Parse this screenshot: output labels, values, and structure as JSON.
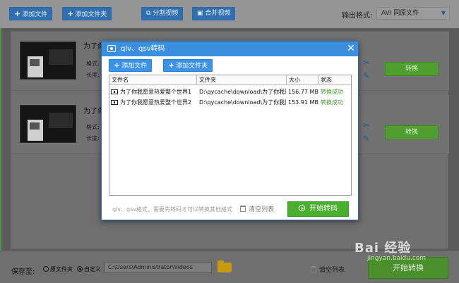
{
  "toolbar": {
    "add_file": "添加文件",
    "add_folder": "添加文件夹",
    "split_video": "分割视频",
    "merge_video": "合并视频",
    "output_format_label": "输出格式:",
    "output_format_value": "AVI 同原文件"
  },
  "cards": [
    {
      "title": "为了你",
      "format_label": "格式:",
      "length_label": "长度:",
      "convert": "转换"
    },
    {
      "title": "为了你",
      "format_label": "格式:",
      "length_label": "长度:",
      "convert": "转换"
    }
  ],
  "bottom": {
    "save_to": "保存至:",
    "option_source": "原文件夹",
    "option_custom": "自定义",
    "path": "C:\\Users\\Administrator\\Videos",
    "clear_list": "清空列表",
    "start_convert": "开始转换"
  },
  "dialog": {
    "title": "qlv、qsv转码",
    "add_file": "添加文件",
    "add_folder": "添加文件夹",
    "columns": [
      "文件名",
      "文件夹",
      "大小",
      "状态"
    ],
    "rows": [
      {
        "name": "为了你我愿意热爱整个世界1",
        "folder": "D:\\qycache\\download\\为了你我愿",
        "size": "156.77 MB",
        "status": "转换成功"
      },
      {
        "name": "为了你我愿意热爱整个世界2",
        "folder": "D:\\qycache\\download\\为了你我愿",
        "size": "153.91 MB",
        "status": "转换成功"
      }
    ],
    "hint": "qlv、qsv格式，需要先转码才可以转换其他格式",
    "clear_list": "清空列表",
    "start_transcode": "开始转码"
  },
  "watermark": {
    "text": "Bai 经验",
    "sub": "jingyan.baidu.com"
  },
  "colors": {
    "accent_blue": "#3b8fe0",
    "success_green": "#4aae2f",
    "status_ok": "#3f9a2a"
  }
}
